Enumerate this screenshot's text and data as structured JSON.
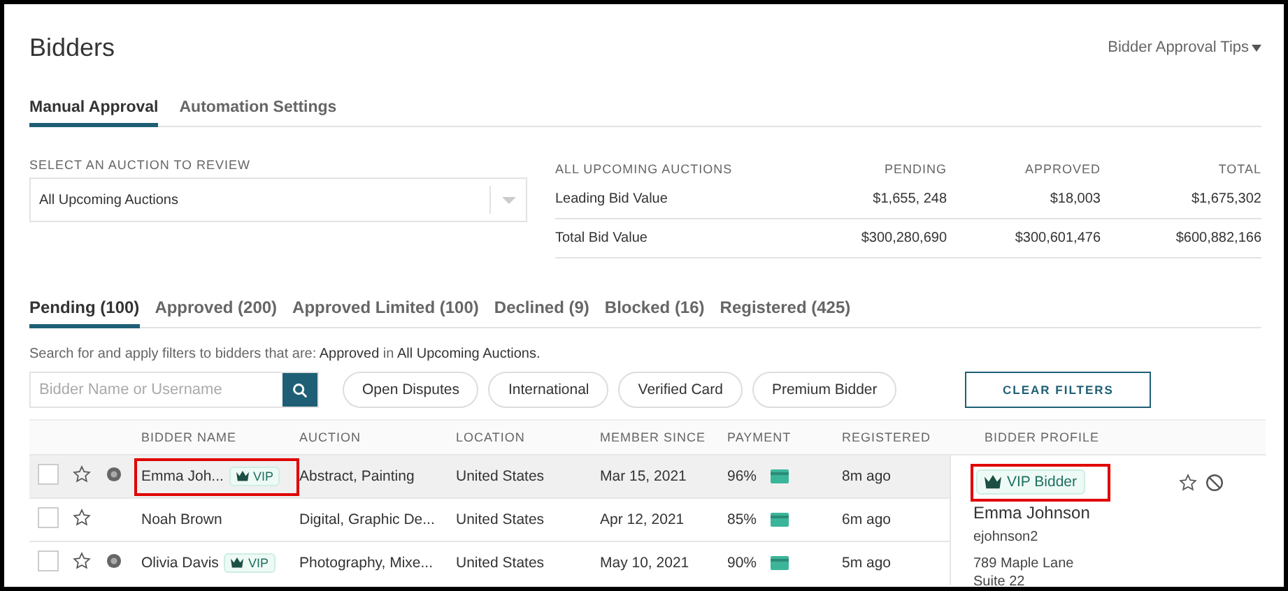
{
  "page": {
    "title": "Bidders",
    "tips_menu": "Bidder Approval Tips"
  },
  "view_tabs": [
    {
      "label": "Manual Approval",
      "selected": true
    },
    {
      "label": "Automation Settings",
      "selected": false
    }
  ],
  "auction_select": {
    "label": "SELECT AN AUCTION TO REVIEW",
    "value": "All Upcoming Auctions"
  },
  "summary": {
    "columns": [
      "ALL UPCOMING AUCTIONS",
      "PENDING",
      "APPROVED",
      "TOTAL"
    ],
    "rows": [
      [
        "Leading Bid Value",
        "$1,655, 248",
        "$18,003",
        "$1,675,302"
      ],
      [
        "Total Bid Value",
        "$300,280,690",
        "$300,601,476",
        "$600,882,166"
      ]
    ]
  },
  "status_tabs": [
    {
      "label": "Pending (100)",
      "selected": true
    },
    {
      "label": "Approved (200)",
      "selected": false
    },
    {
      "label": "Approved Limited (100)",
      "selected": false
    },
    {
      "label": "Declined (9)",
      "selected": false
    },
    {
      "label": "Blocked (16)",
      "selected": false
    },
    {
      "label": "Registered (425)",
      "selected": false
    }
  ],
  "filter_hint": "Search for and apply filters to bidders that are: **Approved** in **All Upcoming Auctions.**",
  "search": {
    "placeholder": "Bidder Name or Username"
  },
  "filters": [
    "Open Disputes",
    "International",
    "Verified Card",
    "Premium Bidder"
  ],
  "clear_button": "CLEAR FILTERS",
  "table": {
    "columns": [
      "BIDDER NAME",
      "AUCTION",
      "LOCATION",
      "MEMBER SINCE",
      "PAYMENT",
      "REGISTERED"
    ],
    "rows": [
      {
        "selected": true,
        "checked": false,
        "starred": false,
        "verified": true,
        "highlighted": true,
        "name": "Emma Joh...",
        "vip": "VIP",
        "auction": "Abstract, Painting",
        "location": "United States",
        "member_since": "Mar 15, 2021",
        "payment": "96%",
        "registered": "8m ago"
      },
      {
        "selected": false,
        "checked": false,
        "starred": false,
        "verified": false,
        "highlighted": false,
        "name": "Noah Brown",
        "auction": "Digital, Graphic De...",
        "location": "United States",
        "member_since": "Apr 12, 2021",
        "payment": "85%",
        "registered": "6m ago"
      },
      {
        "selected": false,
        "checked": false,
        "starred": false,
        "verified": true,
        "highlighted": false,
        "name": "Olivia Davis",
        "vip": "VIP",
        "auction": "Photography, Mixe...",
        "location": "United States",
        "member_since": "May 10, 2021",
        "payment": "90%",
        "registered": "5m ago"
      }
    ]
  },
  "profile": {
    "heading": "BIDDER PROFILE",
    "badge": "VIP Bidder",
    "highlighted": true,
    "starred": false,
    "name": "Emma Johnson",
    "username": "ejohnson2",
    "address": [
      "789 Maple Lane",
      "Suite 22"
    ]
  }
}
